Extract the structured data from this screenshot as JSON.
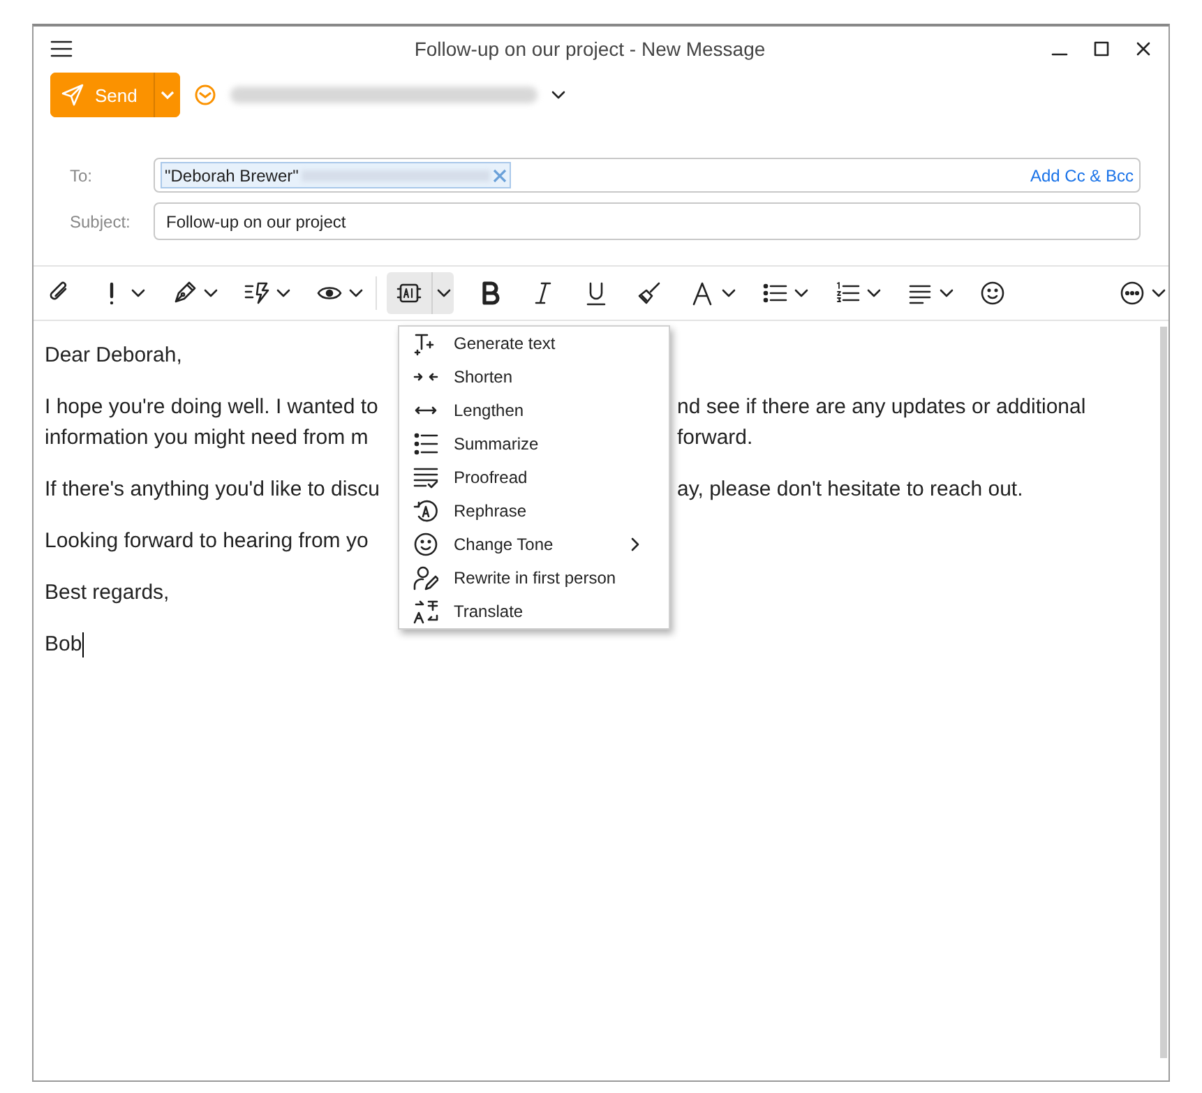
{
  "window": {
    "title": "Follow-up on our project - New Message"
  },
  "send_button": {
    "label": "Send"
  },
  "to": {
    "label": "To:",
    "recipients": [
      {
        "name": "\"Deborah Brewer\""
      }
    ],
    "add_cc_bcc": "Add Cc & Bcc"
  },
  "subject": {
    "label": "Subject:",
    "value": "Follow-up on our project"
  },
  "toolbar": [
    {
      "kind": "attach",
      "dropdown": false
    },
    {
      "kind": "importance",
      "dropdown": true
    },
    {
      "kind": "signature",
      "dropdown": true
    },
    {
      "kind": "quick",
      "dropdown": true
    },
    {
      "kind": "view",
      "dropdown": true
    },
    {
      "kind": "ai",
      "dropdown": true,
      "expanded": true
    },
    {
      "kind": "bold",
      "dropdown": false
    },
    {
      "kind": "italic",
      "dropdown": false
    },
    {
      "kind": "underline",
      "dropdown": false
    },
    {
      "kind": "brush",
      "dropdown": false
    },
    {
      "kind": "font",
      "dropdown": true
    },
    {
      "kind": "bullets",
      "dropdown": true
    },
    {
      "kind": "numbers",
      "dropdown": true
    },
    {
      "kind": "align",
      "dropdown": true
    },
    {
      "kind": "emoji",
      "dropdown": false
    },
    {
      "kind": "more",
      "dropdown": true
    }
  ],
  "body": [
    [
      {
        "left": "Dear Deborah,"
      }
    ],
    [
      {
        "left": "I hope you're doing well. I wanted to",
        "right": "nd see if there are any updates or additional"
      },
      {
        "left": "information you might need from m",
        "right": "forward."
      }
    ],
    [
      {
        "left": "If there's anything you'd like to discu",
        "right": "ay, please don't hesitate to reach out."
      }
    ],
    [
      {
        "left": "Looking forward to hearing from yo"
      }
    ],
    [
      {
        "left": "Best regards,"
      }
    ],
    [
      {
        "left": "Bob"
      }
    ]
  ],
  "ai_menu": {
    "items": [
      {
        "kind": "generate",
        "label": "Generate text",
        "submenu": false
      },
      {
        "kind": "shorten",
        "label": "Shorten",
        "submenu": false
      },
      {
        "kind": "lengthen",
        "label": "Lengthen",
        "submenu": false
      },
      {
        "kind": "summarize",
        "label": "Summarize",
        "submenu": false
      },
      {
        "kind": "proofread",
        "label": "Proofread",
        "submenu": false
      },
      {
        "kind": "rephrase",
        "label": "Rephrase",
        "submenu": false
      },
      {
        "kind": "tone",
        "label": "Change Tone",
        "submenu": true
      },
      {
        "kind": "person",
        "label": "Rewrite in first person",
        "submenu": false
      },
      {
        "kind": "translate",
        "label": "Translate",
        "submenu": false
      }
    ]
  }
}
